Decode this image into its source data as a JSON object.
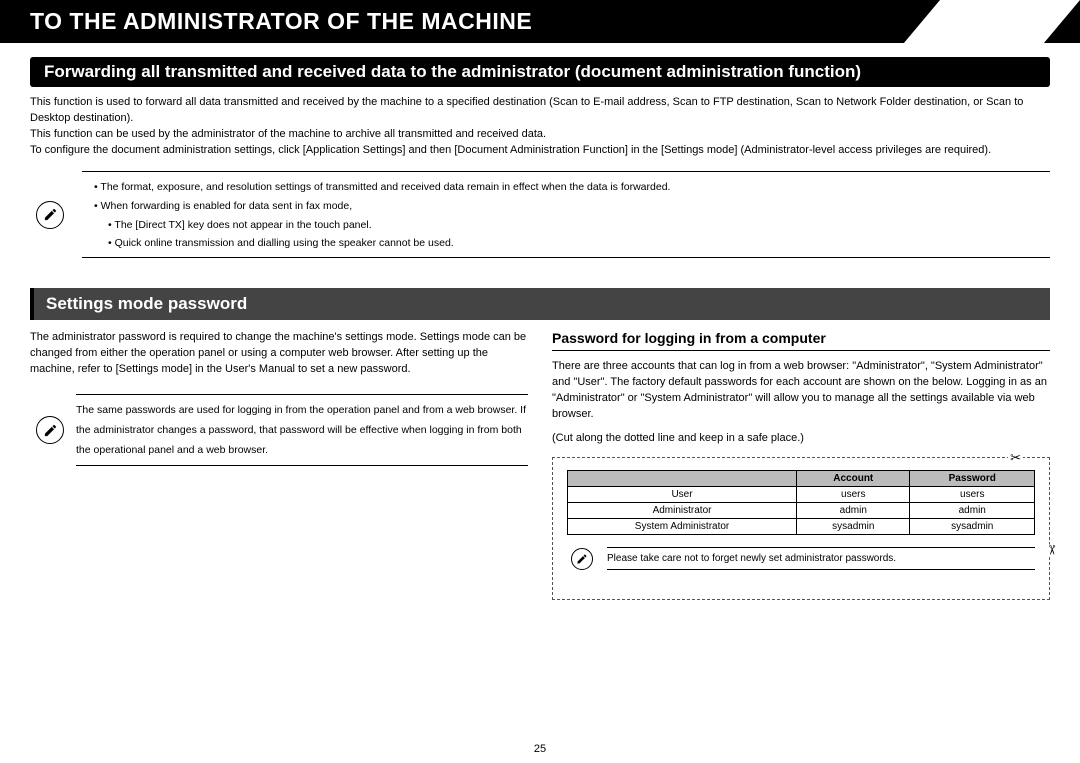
{
  "chapterTitle": "TO THE ADMINISTRATOR OF THE MACHINE",
  "section1": {
    "heading": "Forwarding all transmitted and received data to the administrator (document administration function)",
    "para1": "This function is used to forward all data transmitted and received by the machine to a specified destination (Scan to E-mail address, Scan to FTP destination, Scan to Network Folder destination, or Scan to Desktop destination).",
    "para2": "This function can be used by the administrator of the machine to archive all transmitted and received data.",
    "para3": "To configure the document administration settings, click [Application Settings] and then [Document Administration Function] in the [Settings mode] (Administrator-level access privileges are required).",
    "note": {
      "b1": "The format, exposure, and resolution settings of transmitted and received data remain in effect when the data is forwarded.",
      "b2": "When forwarding is enabled for data sent in fax mode,",
      "b2a": "The [Direct TX] key does not appear in the touch panel.",
      "b2b": "Quick online transmission and dialling using the speaker cannot be used."
    }
  },
  "section2": {
    "heading": "Settings mode password",
    "leftPara": "The administrator password is required to change the machine's settings mode. Settings mode can be changed from either the operation panel or using a computer web browser. After setting up the machine, refer to [Settings mode] in the User's Manual to set a new password.",
    "leftNote": "The same passwords are used for logging in from the operation panel and from a web browser. If the administrator changes a password, that password will be effective when logging in from both the operational panel and a web browser.",
    "rightHeading": "Password for logging in from a computer",
    "rightPara": "There are three accounts that can log in from a web browser: \"Administrator\", \"System Administrator\" and \"User\". The factory default passwords for each account are shown on the below. Logging in as an \"Administrator\" or \"System Administrator\" will allow you to manage all the settings available via web browser.",
    "cutLabel": "(Cut along the dotted line and keep in a safe place.)",
    "table": {
      "h1": "",
      "h2": "Account",
      "h3": "Password",
      "rows": [
        {
          "a": "User",
          "b": "users",
          "c": "users"
        },
        {
          "a": "Administrator",
          "b": "admin",
          "c": "admin"
        },
        {
          "a": "System Administrator",
          "b": "sysadmin",
          "c": "sysadmin"
        }
      ]
    },
    "cutNote": "Please take care not to forget newly set administrator passwords."
  },
  "pageNumber": "25"
}
